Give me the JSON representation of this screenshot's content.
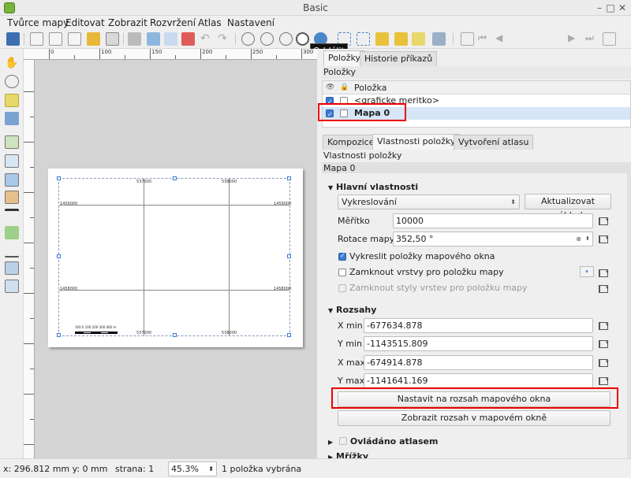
{
  "window": {
    "title": "Basic"
  },
  "menu": [
    "Tvůrce mapy",
    "Editovat",
    "Zobrazit",
    "Rozvržení",
    "Atlas",
    "Nastavení"
  ],
  "tooltip": "Oddálit",
  "toolbar": {
    "page_value": "1"
  },
  "panel_tabs": {
    "items": "Položky",
    "history": "Historie příkazů"
  },
  "items_panel": {
    "title": "Položky",
    "column": "Položka",
    "rows": [
      {
        "label": "<graficke meritko>",
        "visible": true,
        "locked": false,
        "selected": false
      },
      {
        "label": "Mapa 0",
        "visible": true,
        "locked": false,
        "selected": true
      }
    ]
  },
  "prop_tabs": {
    "composition": "Kompozice",
    "item_props": "Vlastnosti položky",
    "atlas": "Vytvoření atlasu"
  },
  "props": {
    "panel_title": "Vlastnosti položky",
    "item_name": "Mapa 0",
    "main_group": "Hlavní vlastnosti",
    "preview_mode": "Vykreslování",
    "update_preview": "Aktualizovat náhled",
    "scale_label": "Měřítko",
    "scale_value": "10000",
    "rotation_label": "Rotace mapy",
    "rotation_value": "352,50 °",
    "draw_items": "Vykreslit položky mapového okna",
    "lock_layers": "Zamknout vrstvy pro položku mapy",
    "lock_styles": "Zamknout styly vrstev pro položku mapy",
    "extents_group": "Rozsahy",
    "xmin_label": "X min",
    "xmin": "-677634.878",
    "ymin_label": "Y min",
    "ymin": "-1143515.809",
    "xmax_label": "X max",
    "xmax": "-674914.878",
    "ymax_label": "Y max",
    "ymax": "-1141641.169",
    "set_extent": "Nastavit na rozsah mapového okna",
    "view_extent": "Zobrazit rozsah v mapovém okně",
    "atlas_group": "Ovládáno atlasem",
    "grids_group": "Mřížky"
  },
  "map": {
    "coord_top_1": "537000",
    "coord_top_2": "538000",
    "coord_bot_1": "537000",
    "coord_bot_2": "538000",
    "coord_left_1": "1459000",
    "coord_left_2": "1458000",
    "coord_right_1": "1459000",
    "coord_right_2": "1458000",
    "scale_labels": "100  0   100   200  300  400 m"
  },
  "status": {
    "coords": "x: 296.812 mm y: 0 mm",
    "page": "strana: 1",
    "zoom": "45.3%",
    "selection": "1 položka vybrána"
  },
  "colors": {
    "accent": "#3b7bd4",
    "highlight": "#e00000"
  }
}
